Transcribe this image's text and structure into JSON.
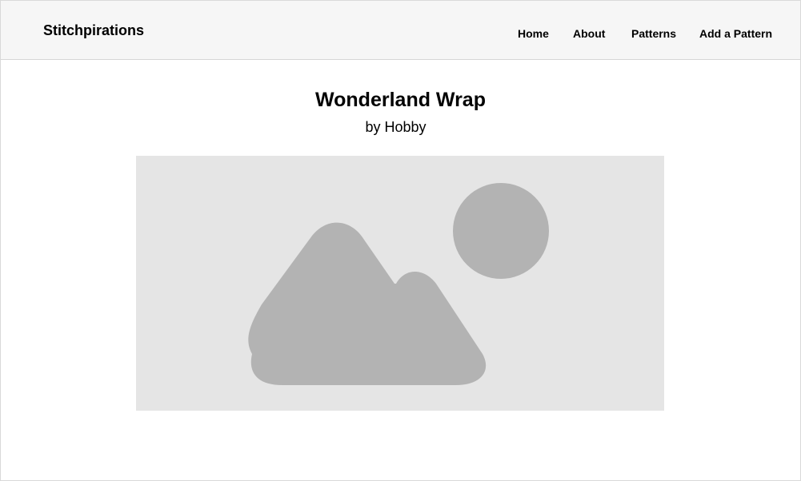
{
  "navbar": {
    "brand": "Stitchpirations",
    "links": [
      "Home",
      "About",
      "Patterns",
      "Add a Pattern"
    ]
  },
  "pattern": {
    "title": "Wonderland Wrap",
    "byline": "by Hobby",
    "image_icon": "image-placeholder-icon"
  },
  "colors": {
    "navbar_bg": "#f6f6f6",
    "image_bg": "#e5e5e5",
    "image_shapes": "#b3b3b3"
  }
}
